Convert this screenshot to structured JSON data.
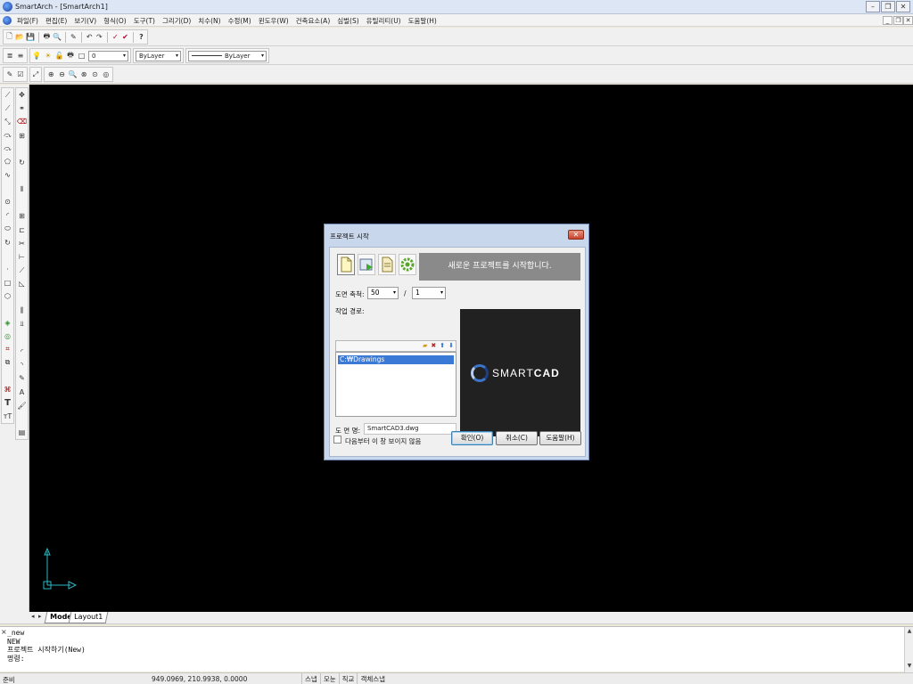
{
  "app": {
    "title": "SmartArch - [SmartArch1]"
  },
  "menu": {
    "items": [
      "파일(F)",
      "편집(E)",
      "보기(V)",
      "형식(O)",
      "도구(T)",
      "그리기(D)",
      "치수(N)",
      "수정(M)",
      "윈도우(W)",
      "건축요소(A)",
      "심벌(S)",
      "유틸리티(U)",
      "도움말(H)"
    ]
  },
  "toolbar": {
    "layer_value": "0",
    "color_value": "ByLayer",
    "linetype_value": "ByLayer"
  },
  "tabs": {
    "model": "Model",
    "layout1": "Layout1"
  },
  "command": {
    "lines": [
      "_new",
      "NEW",
      "프로젝트 시작하기(New)",
      "명령:"
    ]
  },
  "status": {
    "ready": "준비",
    "coords": "949.0969, 210.9938, 0.0000",
    "toggles": [
      "스냅",
      "모눈",
      "직교",
      "객체스냅"
    ]
  },
  "dialog": {
    "title": "프로젝트 시작",
    "banner": "새로운 프로젝트를 시작합니다.",
    "scale_label": "도면 축척:",
    "scale_value1": "50",
    "scale_sep": "/",
    "scale_value2": "1",
    "path_label": "작업 경로:",
    "path_item": "C:₩Drawings",
    "filename_label": "도 면 명:",
    "filename_value": "SmartCAD3.dwg",
    "dont_show_label": "다음부터 이 창 보이지 않음",
    "ok_label": "확인(O)",
    "cancel_label": "취소(C)",
    "help_label": "도움말(H)",
    "logo_text_a": "SMART",
    "logo_text_b": "CAD"
  }
}
